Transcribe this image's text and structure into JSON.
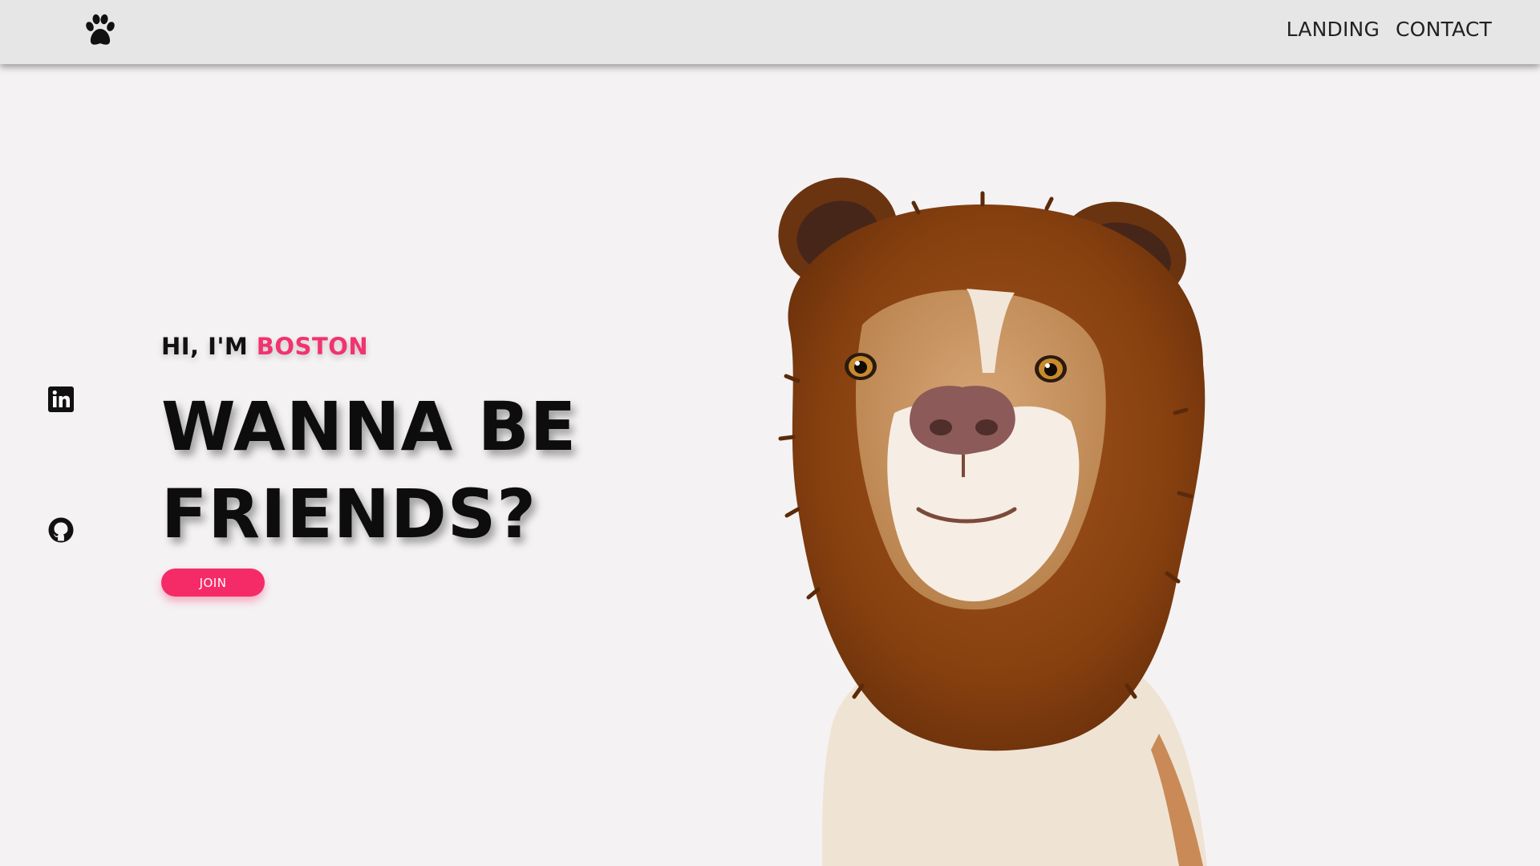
{
  "header": {
    "logo_icon": "paw-icon",
    "nav": [
      {
        "label": "LANDING"
      },
      {
        "label": "CONTACT"
      }
    ]
  },
  "social": [
    {
      "icon": "linkedin-icon"
    },
    {
      "icon": "github-icon"
    }
  ],
  "hero": {
    "greeting_prefix": "HI, I'M ",
    "greeting_name": "BOSTON",
    "headline_line1": "WANNA BE",
    "headline_line2": "FRIENDS?",
    "join_label": "JOIN"
  },
  "image": {
    "subject": "dog-in-bear-hood"
  },
  "colors": {
    "accent": "#f1336f",
    "button": "#f52b68",
    "page_bg": "#f4f2f3",
    "header_bg": "#e6e6e6",
    "text": "#111111"
  }
}
